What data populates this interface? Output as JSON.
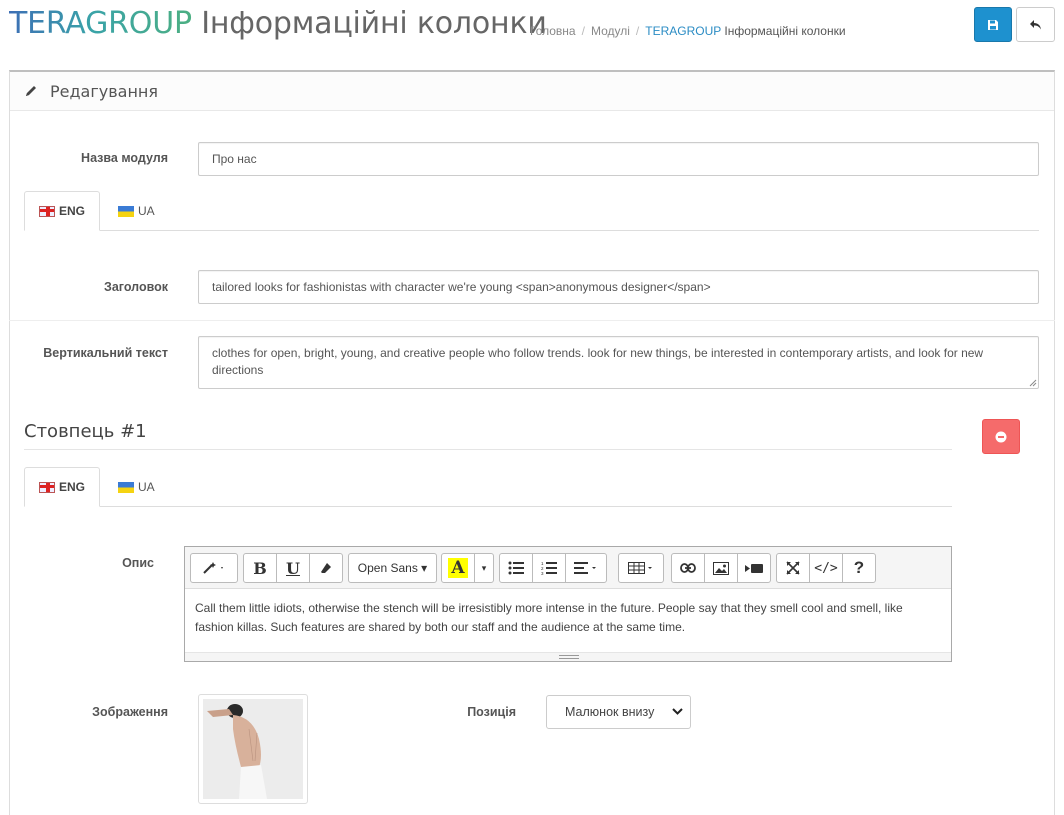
{
  "header": {
    "title_brand": "TERAGROUP",
    "title_rest": " Інформаційні колонки",
    "breadcrumb": {
      "home": "Головна",
      "modules": "Модулі",
      "current_brand": "TERAGROUP",
      "current_rest": " Інформаційні колонки"
    },
    "save_icon": "save-icon",
    "back_icon": "reply-icon",
    "accent_color": "#1e91cf"
  },
  "panel": {
    "heading": "Редагування",
    "heading_icon": "pencil-icon"
  },
  "form": {
    "module_name_label": "Назва модуля",
    "module_name_value": "Про нас",
    "lang_tabs": [
      {
        "label": "ENG",
        "icon": "flag-gb-icon",
        "active": true
      },
      {
        "label": "UA",
        "icon": "flag-ua-icon",
        "active": false
      }
    ],
    "heading_label": "Заголовок",
    "heading_value": "tailored looks for fashionistas with character we're young <span>anonymous designer</span>",
    "vertical_label": "Вертикальний текст",
    "vertical_value": "clothes for open, bright, young, and creative people who follow trends. look for new things, be interested in contemporary artists, and look for new directions"
  },
  "column": {
    "title": "Стовпець #1",
    "remove_icon": "minus-circle-icon",
    "remove_color": "#f56b6b",
    "lang_tabs": [
      {
        "label": "ENG",
        "icon": "flag-gb-icon",
        "active": true
      },
      {
        "label": "UA",
        "icon": "flag-ua-icon",
        "active": false
      }
    ],
    "description_label": "Опис",
    "editor": {
      "font_name": "Open Sans",
      "content": "Call them little idiots, otherwise the stench will be irresistibly more intense in the future. People say that they smell cool and smell, like fashion killas. Such features are shared by both our staff and the audience at the same time.",
      "toolbar_icons": [
        "magic-icon",
        "bold-icon",
        "underline-icon",
        "eraser-icon",
        "font-color-icon",
        "unordered-list-icon",
        "ordered-list-icon",
        "align-icon",
        "table-icon",
        "link-icon",
        "picture-icon",
        "video-icon",
        "fullscreen-icon",
        "code-view-icon",
        "help-icon"
      ]
    },
    "image_label": "Зображення",
    "position_label": "Позиція",
    "position_value": "Малюнок внизу"
  }
}
